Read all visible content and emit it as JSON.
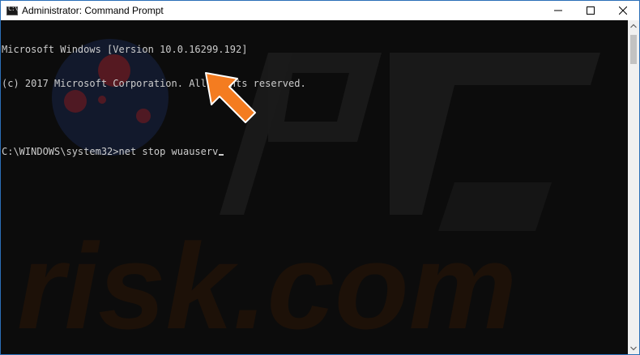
{
  "window": {
    "title": "Administrator: Command Prompt",
    "app_icon_glyph": "C:\\",
    "icons": {
      "app": "command-prompt-icon",
      "minimize": "minimize-icon",
      "maximize": "maximize-icon",
      "close": "close-icon",
      "scroll_up": "chevron-up-icon",
      "scroll_down": "chevron-down-icon",
      "annotation": "arrow-pointer-icon"
    }
  },
  "console": {
    "lines": [
      "Microsoft Windows [Version 10.0.16299.192]",
      "(c) 2017 Microsoft Corporation. All rights reserved.",
      "",
      "C:\\WINDOWS\\system32>net stop wuauserv"
    ]
  },
  "colors": {
    "console_background": "#0c0c0c",
    "console_text": "#cccccc",
    "titlebar": "#ffffff",
    "arrow": "#f47c20"
  },
  "watermark": {
    "text": "risk.com"
  }
}
